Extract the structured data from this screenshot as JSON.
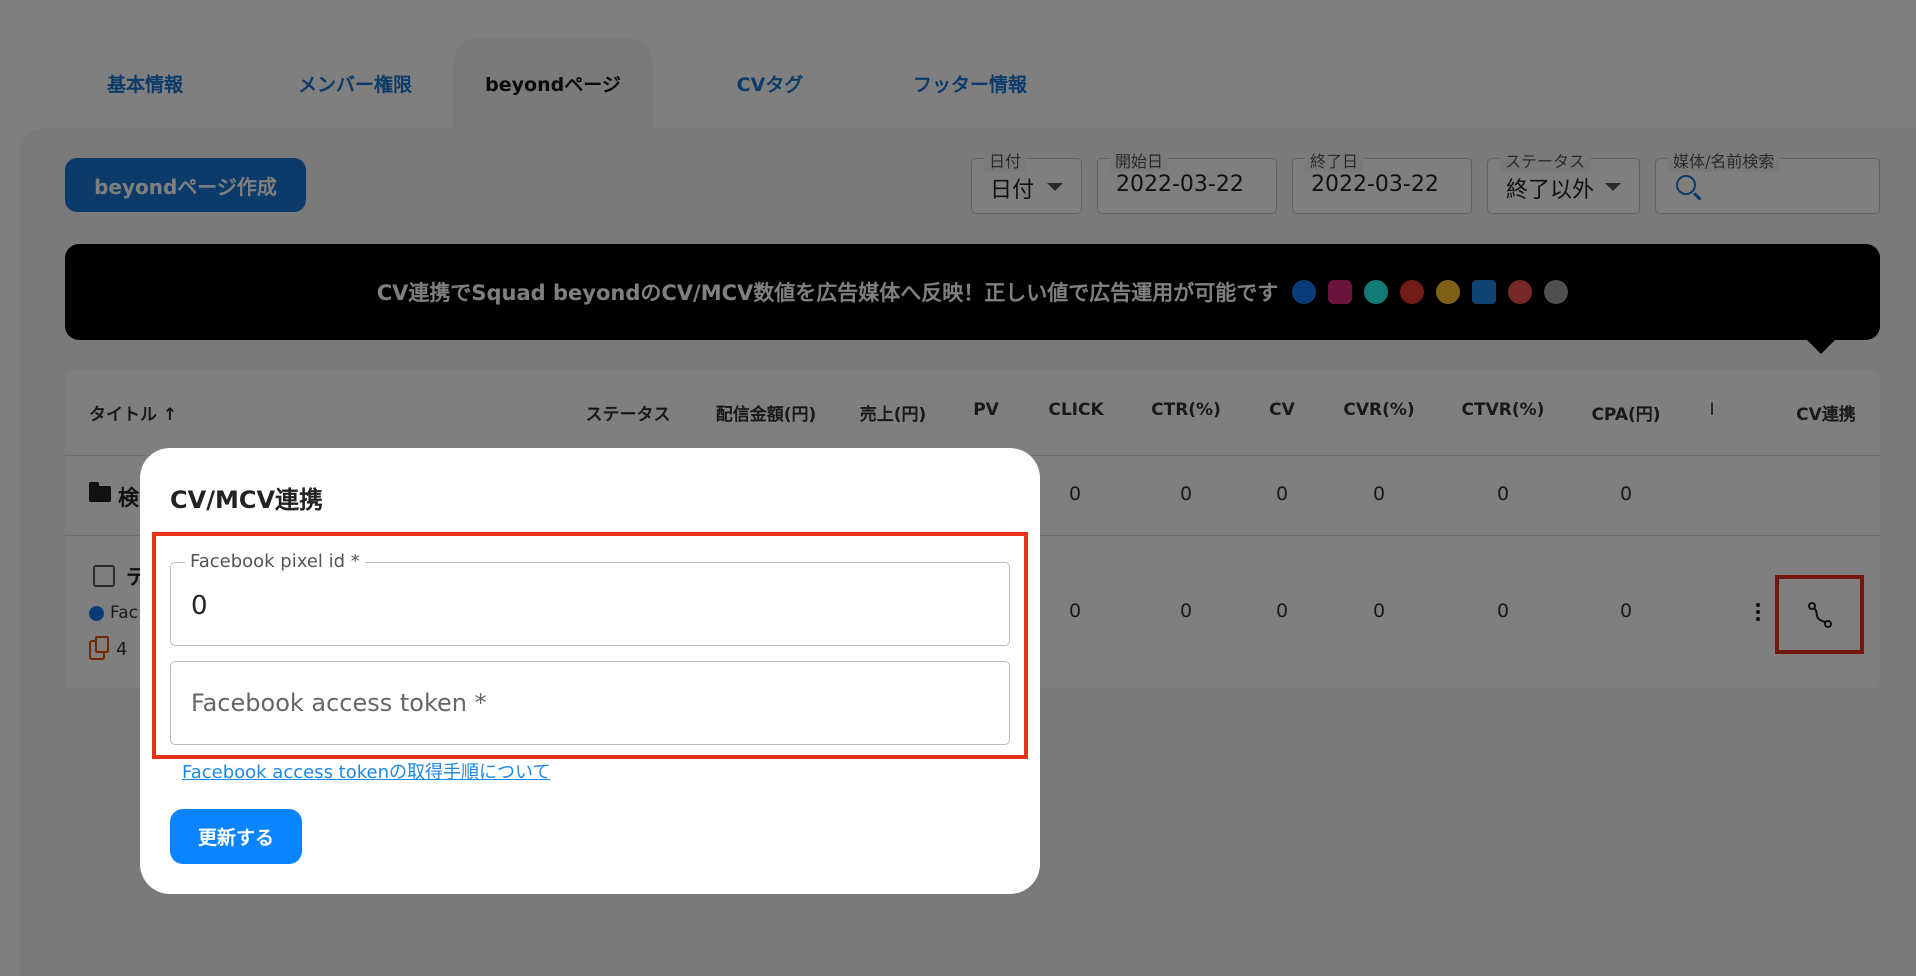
{
  "tabs": [
    {
      "label": "基本情報"
    },
    {
      "label": "メンバー権限"
    },
    {
      "label": "beyondページ"
    },
    {
      "label": "CVタグ"
    },
    {
      "label": "フッター情報"
    }
  ],
  "toolbar": {
    "create_label": "beyondページ作成"
  },
  "filters": {
    "date_type": {
      "label": "日付",
      "value": "日付"
    },
    "start_date": {
      "label": "開始日",
      "value": "2022-03-22"
    },
    "end_date": {
      "label": "終了日",
      "value": "2022-03-22"
    },
    "status": {
      "label": "ステータス",
      "value": "終了以外"
    },
    "search": {
      "label": "媒体/名前検索"
    }
  },
  "banner": {
    "text": "CV連携でSquad beyondのCV/MCV数値を広告媒体へ反映！正しい値で広告運用が可能です",
    "media_icons": [
      {
        "name": "facebook-icon",
        "color": "#1877f2"
      },
      {
        "name": "instagram-icon",
        "color": "#d62976"
      },
      {
        "name": "tiktok-icon",
        "color": "#25f4ee"
      },
      {
        "name": "smartnews-icon",
        "color": "#e53935"
      },
      {
        "name": "yahoo-icon",
        "color": "#fbc02d"
      },
      {
        "name": "line-icon",
        "color": "#1e88e5"
      },
      {
        "name": "gunosy-icon",
        "color": "#ef5350"
      },
      {
        "name": "other-media-icon",
        "color": "#9e9e9e"
      }
    ]
  },
  "table": {
    "headers": {
      "title": "タイトル ↑",
      "status": "ステータス",
      "spend": "配信金額(円)",
      "sales": "売上(円)",
      "pv": "PV",
      "click": "CLICK",
      "ctr": "CTR(%)",
      "cv": "CV",
      "cvr": "CVR(%)",
      "ctvr": "CTVR(%)",
      "cpa": "CPA(円)",
      "extra": "I",
      "cv_link": "CV連携"
    },
    "row1": {
      "label": "検",
      "values": [
        "0",
        "0",
        "0",
        "0",
        "0",
        "0"
      ]
    },
    "row2": {
      "title": "テ",
      "media": "Fac",
      "copies": "4",
      "values": [
        "0",
        "0",
        "0",
        "0",
        "0",
        "0"
      ]
    }
  },
  "dialog": {
    "title": "CV/MCV連携",
    "pixel_field": {
      "label": "Facebook pixel id *",
      "value": "0"
    },
    "token_field": {
      "placeholder": "Facebook access token *"
    },
    "help_link": "Facebook access tokenの取得手順について",
    "submit_label": "更新する"
  },
  "colors": {
    "accent": "#1976d2",
    "highlight": "#e7311a",
    "submit": "#0a84ff"
  }
}
